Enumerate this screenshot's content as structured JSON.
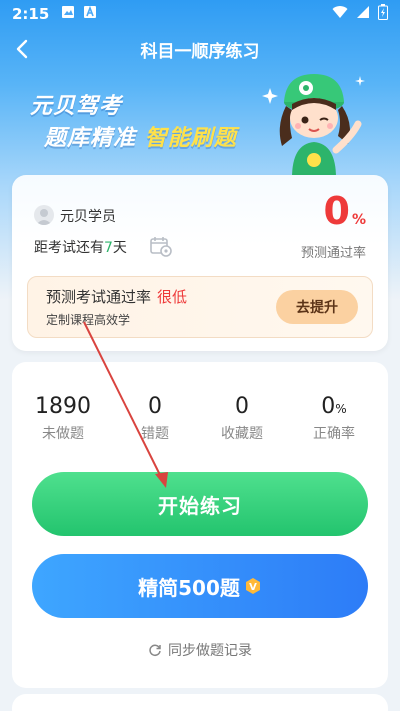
{
  "status_bar": {
    "time": "2:15"
  },
  "nav": {
    "title": "科目一顺序练习"
  },
  "banner": {
    "line1": "元贝驾考",
    "line2_a": "题库精准",
    "line2_b": "智能刷题"
  },
  "profile": {
    "username": "元贝学员",
    "countdown_prefix": "距考试还有",
    "countdown_days": "7",
    "countdown_suffix": "天",
    "pass_rate_value": "0",
    "pass_rate_unit": "%",
    "pass_rate_label": "预测通过率"
  },
  "alert": {
    "title": "预测考试通过率",
    "level": "很低",
    "subtitle": "定制课程高效学",
    "button": "去提升"
  },
  "stats": [
    {
      "value": "1890",
      "unit": "",
      "label": "未做题"
    },
    {
      "value": "0",
      "unit": "",
      "label": "错题"
    },
    {
      "value": "0",
      "unit": "",
      "label": "收藏题"
    },
    {
      "value": "0",
      "unit": "%",
      "label": "正确率"
    }
  ],
  "actions": {
    "start": "开始练习",
    "simplified": "精简500题",
    "vip_badge": "V",
    "sync": "同步做题记录"
  },
  "colors": {
    "accent_green": "#23c46e",
    "accent_blue": "#2d7cf7",
    "warning_red": "#ee3a3a",
    "annotation_arrow": "#d9443f"
  }
}
